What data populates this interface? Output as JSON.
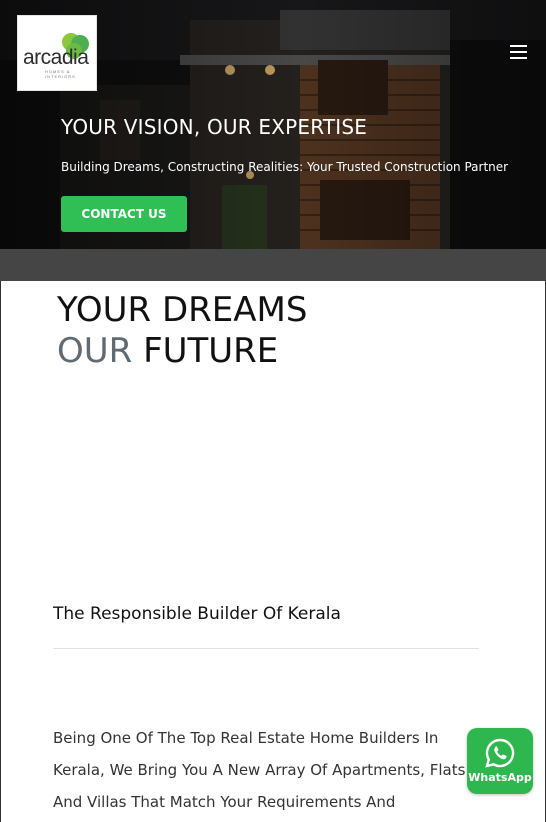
{
  "header": {
    "logo_text": "arcadia",
    "logo_tagline": "HOMES & INTERIORS",
    "menu_icon": "hamburger-menu-icon"
  },
  "hero": {
    "title": "YOUR VISION, OUR EXPERTISE",
    "subtitle": "Building Dreams, Constructing Realities: Your Trusted Construction Partner",
    "cta_label": "CONTACT US"
  },
  "intro": {
    "line1": "YOUR DREAMS",
    "line2_muted": "OUR",
    "line2_rest": " FUTURE"
  },
  "about": {
    "title": "The Responsible Builder Of Kerala",
    "body": "Being One Of The Top Real Estate Home Builders In Kerala, We Bring You A New Array Of Apartments, Flats And Villas That Match Your Requirements And"
  },
  "whatsapp": {
    "label": "WhatsApp",
    "icon": "whatsapp-icon"
  },
  "colors": {
    "accent_green": "#2fbf55",
    "whatsapp_green": "#2fb74f",
    "band_gray": "#454545",
    "muted_text": "#5f6a73"
  }
}
